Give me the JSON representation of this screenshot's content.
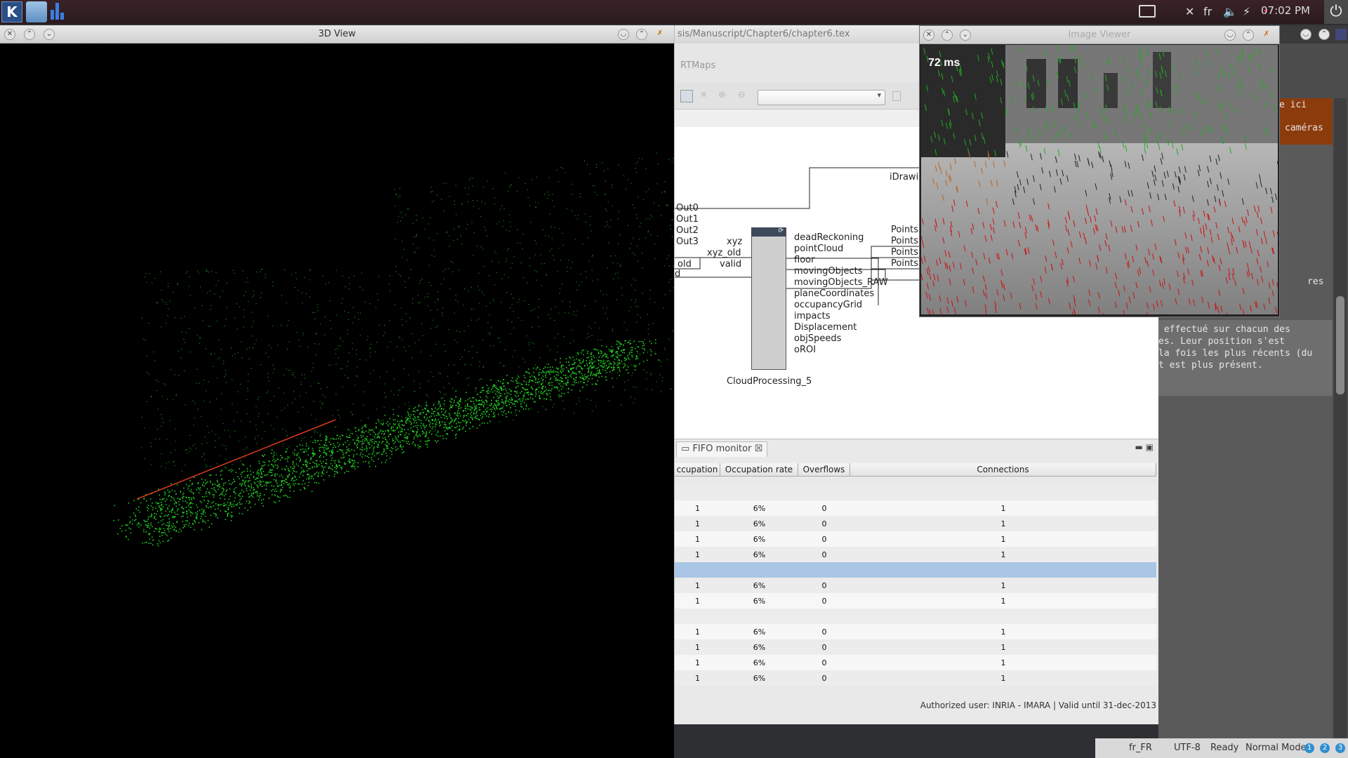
{
  "taskbar": {
    "launcher_k": "K",
    "tray_lang": "fr",
    "clock": "07:02 PM",
    "power_icon": "power-icon"
  },
  "window_3d": {
    "title": "3D View"
  },
  "rtmaps": {
    "path_title": "sis/Manuscript/Chapter6/chapter6.tex",
    "subtitle": "RTMaps",
    "left_ports": [
      "Out0",
      "Out1",
      "Out2",
      "Out3",
      "old",
      "d"
    ],
    "in_ports": [
      "xyz",
      "xyz_old",
      "valid"
    ],
    "out_ports": [
      "deadReckoning",
      "pointCloud",
      "floor",
      "movingObjects",
      "movingObjects_RAW",
      "planeCoordinates",
      "occupancyGrid",
      "impacts",
      "Displacement",
      "objSpeeds",
      "oROI"
    ],
    "component_name": "CloudProcessing_5",
    "right_label": "iDrawin",
    "points_labels": [
      "Points",
      "Points",
      "Points",
      "Points"
    ],
    "fifo": {
      "tab_label": "FIFO monitor",
      "columns": [
        "ccupation",
        "Occupation rate",
        "Overflows",
        "Connections"
      ],
      "rows": [
        {
          "occ": "",
          "rate": "",
          "ovf": "",
          "conn": "",
          "type": "empty"
        },
        {
          "occ": "1",
          "rate": "6%",
          "ovf": "0",
          "conn": "1",
          "type": "data"
        },
        {
          "occ": "1",
          "rate": "6%",
          "ovf": "0",
          "conn": "1",
          "type": "data"
        },
        {
          "occ": "1",
          "rate": "6%",
          "ovf": "0",
          "conn": "1",
          "type": "data"
        },
        {
          "occ": "1",
          "rate": "6%",
          "ovf": "0",
          "conn": "1",
          "type": "data"
        },
        {
          "occ": "",
          "rate": "",
          "ovf": "",
          "conn": "",
          "type": "selected"
        },
        {
          "occ": "1",
          "rate": "6%",
          "ovf": "0",
          "conn": "1",
          "type": "data"
        },
        {
          "occ": "1",
          "rate": "6%",
          "ovf": "0",
          "conn": "1",
          "type": "data"
        },
        {
          "occ": "",
          "rate": "",
          "ovf": "",
          "conn": "",
          "type": "empty"
        },
        {
          "occ": "1",
          "rate": "6%",
          "ovf": "0",
          "conn": "1",
          "type": "data"
        },
        {
          "occ": "1",
          "rate": "6%",
          "ovf": "0",
          "conn": "1",
          "type": "data"
        },
        {
          "occ": "1",
          "rate": "6%",
          "ovf": "0",
          "conn": "1",
          "type": "data"
        },
        {
          "occ": "1",
          "rate": "6%",
          "ovf": "0",
          "conn": "1",
          "type": "data"
        }
      ],
      "authorized": "Authorized user: INRIA - IMARA | Valid until 31-dec-2013"
    }
  },
  "image_viewer": {
    "title": "Image Viewer",
    "timing": "72 ms"
  },
  "editor": {
    "line1": "e ici",
    "line2": "caméras",
    "line3": "res",
    "para": [
      " effectué sur chacun des",
      "es. Leur position s'est",
      "la fois les plus récents (du",
      "t est plus présent."
    ],
    "status_locale": "fr_FR",
    "status_encoding": "UTF-8",
    "status_ready": "Ready",
    "status_mode": "Normal Mode",
    "badges": [
      "1",
      "2",
      "3"
    ]
  }
}
